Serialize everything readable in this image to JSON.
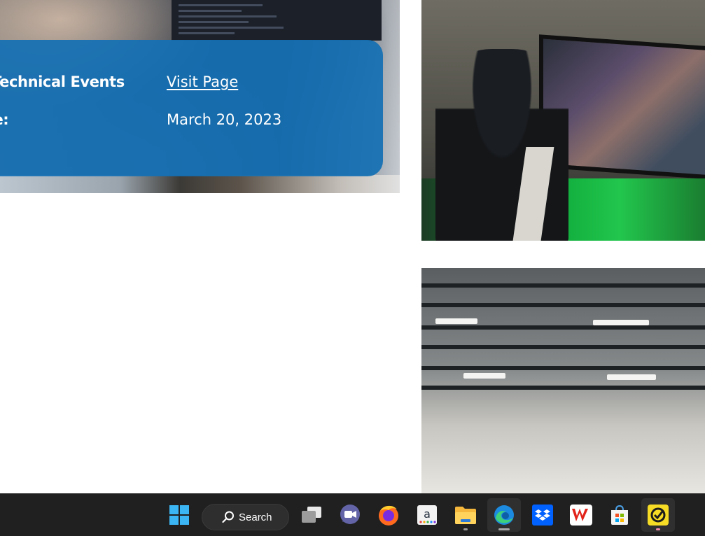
{
  "event_card": {
    "category_label": "Technical Events",
    "link_label": "Visit Page",
    "date_label": "Date:",
    "date_value": "March 20, 2023"
  },
  "taskbar": {
    "search_label": "Search",
    "apps": [
      {
        "name": "Start",
        "icon": "windows-logo-icon"
      },
      {
        "name": "Task View",
        "icon": "task-view-icon"
      },
      {
        "name": "Meet",
        "icon": "video-chat-icon"
      },
      {
        "name": "Firefox",
        "icon": "firefox-icon"
      },
      {
        "name": "Amazon",
        "icon": "amazon-icon"
      },
      {
        "name": "File Explorer",
        "icon": "folder-icon"
      },
      {
        "name": "Edge",
        "icon": "edge-icon"
      },
      {
        "name": "Dropbox",
        "icon": "dropbox-icon"
      },
      {
        "name": "WPS Office",
        "icon": "wps-office-icon"
      },
      {
        "name": "Microsoft Store",
        "icon": "store-icon"
      },
      {
        "name": "Task app",
        "icon": "checkmark-app-icon"
      }
    ]
  },
  "colors": {
    "card_blue": "#1470b4",
    "taskbar_bg": "#202020"
  }
}
